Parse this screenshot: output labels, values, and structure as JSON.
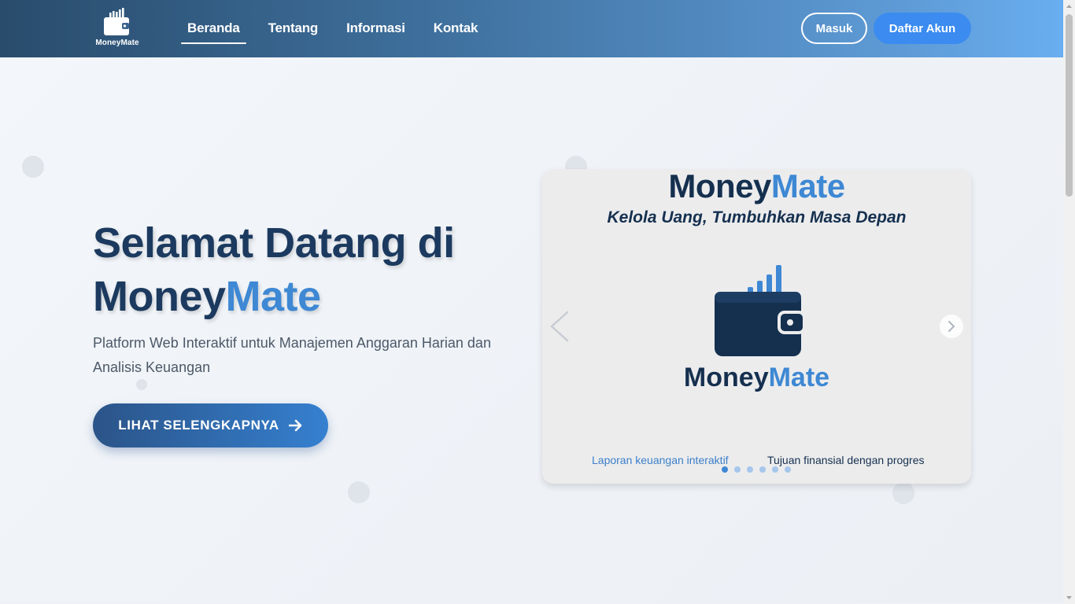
{
  "brand": {
    "name": "MoneyMate",
    "name_primary": "Money",
    "name_accent": "Mate"
  },
  "nav": {
    "items": [
      {
        "label": "Beranda",
        "active": true
      },
      {
        "label": "Tentang",
        "active": false
      },
      {
        "label": "Informasi",
        "active": false
      },
      {
        "label": "Kontak",
        "active": false
      }
    ],
    "login_label": "Masuk",
    "register_label": "Daftar Akun"
  },
  "hero": {
    "title_line1": "Selamat Datang di",
    "title_primary": "Money",
    "title_accent": "Mate",
    "subtitle": "Platform Web Interaktif untuk Manajemen Anggaran Harian dan Analisis Keuangan",
    "cta_label": "LIHAT SELENGKAPNYA",
    "cta_icon": "arrow-right-icon"
  },
  "carousel": {
    "brand_primary": "Money",
    "brand_accent": "Mate",
    "tagline": "Kelola Uang, Tumbuhkan Masa Depan",
    "feature_1": "Laporan keuangan interaktif",
    "feature_2": "Tujuan finansial dengan progres",
    "slide_count": 6,
    "active_slide": 1
  },
  "colors": {
    "navy": "#15304f",
    "accent": "#3e88d4",
    "button_blue": "#3b8bf0"
  }
}
